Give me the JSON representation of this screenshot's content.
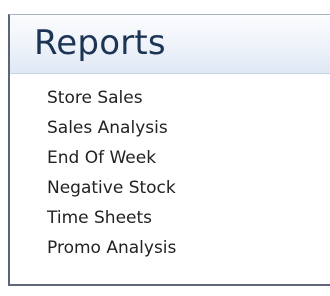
{
  "reports": {
    "title": "Reports",
    "items": [
      {
        "label": "Store Sales"
      },
      {
        "label": "Sales Analysis"
      },
      {
        "label": "End Of Week"
      },
      {
        "label": "Negative Stock"
      },
      {
        "label": "Time Sheets"
      },
      {
        "label": "Promo Analysis"
      }
    ]
  }
}
